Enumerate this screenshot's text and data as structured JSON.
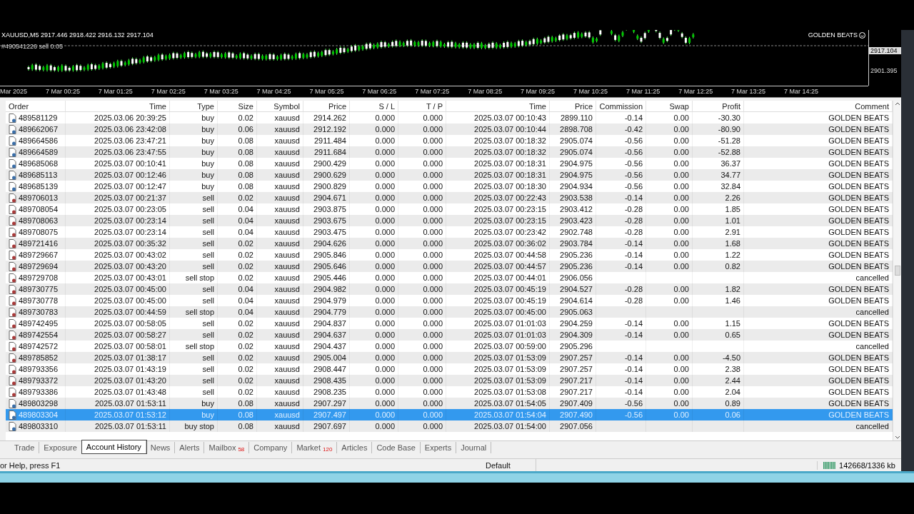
{
  "chart": {
    "title": "XAUUSD,M5  2917.446 2918.422 2916.132 2917.104",
    "order_line": "#490541226 sell 0.05",
    "expert": "GOLDEN BEATS",
    "price_labels": [
      "2917.104",
      "2901.395"
    ],
    "time_labels": [
      "Mar 2025",
      "7 Mar 00:25",
      "7 Mar 01:25",
      "7 Mar 02:25",
      "7 Mar 03:25",
      "7 Mar 04:25",
      "7 Mar 05:25",
      "7 Mar 06:25",
      "7 Mar 07:25",
      "7 Mar 08:25",
      "7 Mar 09:25",
      "7 Mar 10:25",
      "7 Mar 11:25",
      "7 Mar 12:25",
      "7 Mar 13:25",
      "7 Mar 14:25"
    ]
  },
  "table": {
    "columns": [
      "Order",
      "Time",
      "Type",
      "Size",
      "Symbol",
      "Price",
      "S / L",
      "T / P",
      "Time",
      "Price",
      "Commission",
      "Swap",
      "Profit",
      "Comment"
    ],
    "rows": [
      {
        "kind": "buy",
        "selected": false,
        "cells": [
          "489581129",
          "2025.03.06 20:39:25",
          "buy",
          "0.02",
          "xauusd",
          "2914.262",
          "0.000",
          "0.000",
          "2025.03.07 00:10:43",
          "2899.110",
          "-0.14",
          "0.00",
          "-30.30",
          "GOLDEN BEATS"
        ]
      },
      {
        "kind": "buy",
        "selected": false,
        "cells": [
          "489662067",
          "2025.03.06 23:42:08",
          "buy",
          "0.06",
          "xauusd",
          "2912.192",
          "0.000",
          "0.000",
          "2025.03.07 00:10:44",
          "2898.708",
          "-0.42",
          "0.00",
          "-80.90",
          "GOLDEN BEATS"
        ]
      },
      {
        "kind": "buy",
        "selected": false,
        "cells": [
          "489664586",
          "2025.03.06 23:47:21",
          "buy",
          "0.08",
          "xauusd",
          "2911.484",
          "0.000",
          "0.000",
          "2025.03.07 00:18:32",
          "2905.074",
          "-0.56",
          "0.00",
          "-51.28",
          "GOLDEN BEATS"
        ]
      },
      {
        "kind": "buy",
        "selected": false,
        "cells": [
          "489664589",
          "2025.03.06 23:47:55",
          "buy",
          "0.08",
          "xauusd",
          "2911.684",
          "0.000",
          "0.000",
          "2025.03.07 00:18:32",
          "2905.074",
          "-0.56",
          "0.00",
          "-52.88",
          "GOLDEN BEATS"
        ]
      },
      {
        "kind": "buy",
        "selected": false,
        "cells": [
          "489685068",
          "2025.03.07 00:10:41",
          "buy",
          "0.08",
          "xauusd",
          "2900.429",
          "0.000",
          "0.000",
          "2025.03.07 00:18:31",
          "2904.975",
          "-0.56",
          "0.00",
          "36.37",
          "GOLDEN BEATS"
        ]
      },
      {
        "kind": "buy",
        "selected": false,
        "cells": [
          "489685113",
          "2025.03.07 00:12:46",
          "buy",
          "0.08",
          "xauusd",
          "2900.629",
          "0.000",
          "0.000",
          "2025.03.07 00:18:31",
          "2904.975",
          "-0.56",
          "0.00",
          "34.77",
          "GOLDEN BEATS"
        ]
      },
      {
        "kind": "buy",
        "selected": false,
        "cells": [
          "489685139",
          "2025.03.07 00:12:47",
          "buy",
          "0.08",
          "xauusd",
          "2900.829",
          "0.000",
          "0.000",
          "2025.03.07 00:18:30",
          "2904.934",
          "-0.56",
          "0.00",
          "32.84",
          "GOLDEN BEATS"
        ]
      },
      {
        "kind": "sell",
        "selected": false,
        "cells": [
          "489706013",
          "2025.03.07 00:21:37",
          "sell",
          "0.02",
          "xauusd",
          "2904.671",
          "0.000",
          "0.000",
          "2025.03.07 00:22:43",
          "2903.538",
          "-0.14",
          "0.00",
          "2.26",
          "GOLDEN BEATS"
        ]
      },
      {
        "kind": "sell",
        "selected": false,
        "cells": [
          "489708054",
          "2025.03.07 00:23:05",
          "sell",
          "0.04",
          "xauusd",
          "2903.875",
          "0.000",
          "0.000",
          "2025.03.07 00:23:15",
          "2903.412",
          "-0.28",
          "0.00",
          "1.85",
          "GOLDEN BEATS"
        ]
      },
      {
        "kind": "sell",
        "selected": false,
        "cells": [
          "489708063",
          "2025.03.07 00:23:14",
          "sell",
          "0.04",
          "xauusd",
          "2903.675",
          "0.000",
          "0.000",
          "2025.03.07 00:23:15",
          "2903.423",
          "-0.28",
          "0.00",
          "1.01",
          "GOLDEN BEATS"
        ]
      },
      {
        "kind": "sell",
        "selected": false,
        "cells": [
          "489708075",
          "2025.03.07 00:23:14",
          "sell",
          "0.04",
          "xauusd",
          "2903.475",
          "0.000",
          "0.000",
          "2025.03.07 00:23:42",
          "2902.748",
          "-0.28",
          "0.00",
          "2.91",
          "GOLDEN BEATS"
        ]
      },
      {
        "kind": "sell",
        "selected": false,
        "cells": [
          "489721416",
          "2025.03.07 00:35:32",
          "sell",
          "0.02",
          "xauusd",
          "2904.626",
          "0.000",
          "0.000",
          "2025.03.07 00:36:02",
          "2903.784",
          "-0.14",
          "0.00",
          "1.68",
          "GOLDEN BEATS"
        ]
      },
      {
        "kind": "sell",
        "selected": false,
        "cells": [
          "489729667",
          "2025.03.07 00:43:02",
          "sell",
          "0.02",
          "xauusd",
          "2905.846",
          "0.000",
          "0.000",
          "2025.03.07 00:44:58",
          "2905.236",
          "-0.14",
          "0.00",
          "1.22",
          "GOLDEN BEATS"
        ]
      },
      {
        "kind": "sell",
        "selected": false,
        "cells": [
          "489729694",
          "2025.03.07 00:43:20",
          "sell",
          "0.02",
          "xauusd",
          "2905.646",
          "0.000",
          "0.000",
          "2025.03.07 00:44:57",
          "2905.236",
          "-0.14",
          "0.00",
          "0.82",
          "GOLDEN BEATS"
        ]
      },
      {
        "kind": "sell",
        "selected": false,
        "cells": [
          "489729708",
          "2025.03.07 00:43:01",
          "sell stop",
          "0.02",
          "xauusd",
          "2905.446",
          "0.000",
          "0.000",
          "2025.03.07 00:44:01",
          "2906.056",
          null,
          null,
          null,
          "cancelled"
        ]
      },
      {
        "kind": "sell",
        "selected": false,
        "cells": [
          "489730775",
          "2025.03.07 00:45:00",
          "sell",
          "0.04",
          "xauusd",
          "2904.982",
          "0.000",
          "0.000",
          "2025.03.07 00:45:19",
          "2904.527",
          "-0.28",
          "0.00",
          "1.82",
          "GOLDEN BEATS"
        ]
      },
      {
        "kind": "sell",
        "selected": false,
        "cells": [
          "489730778",
          "2025.03.07 00:45:00",
          "sell",
          "0.04",
          "xauusd",
          "2904.979",
          "0.000",
          "0.000",
          "2025.03.07 00:45:19",
          "2904.614",
          "-0.28",
          "0.00",
          "1.46",
          "GOLDEN BEATS"
        ]
      },
      {
        "kind": "sell",
        "selected": false,
        "cells": [
          "489730783",
          "2025.03.07 00:44:59",
          "sell stop",
          "0.04",
          "xauusd",
          "2904.779",
          "0.000",
          "0.000",
          "2025.03.07 00:45:00",
          "2905.063",
          null,
          null,
          null,
          "cancelled"
        ]
      },
      {
        "kind": "sell",
        "selected": false,
        "cells": [
          "489742495",
          "2025.03.07 00:58:05",
          "sell",
          "0.02",
          "xauusd",
          "2904.837",
          "0.000",
          "0.000",
          "2025.03.07 01:01:03",
          "2904.259",
          "-0.14",
          "0.00",
          "1.15",
          "GOLDEN BEATS"
        ]
      },
      {
        "kind": "sell",
        "selected": false,
        "cells": [
          "489742554",
          "2025.03.07 00:58:27",
          "sell",
          "0.02",
          "xauusd",
          "2904.637",
          "0.000",
          "0.000",
          "2025.03.07 01:01:03",
          "2904.309",
          "-0.14",
          "0.00",
          "0.65",
          "GOLDEN BEATS"
        ]
      },
      {
        "kind": "sell",
        "selected": false,
        "cells": [
          "489742572",
          "2025.03.07 00:58:01",
          "sell stop",
          "0.02",
          "xauusd",
          "2904.437",
          "0.000",
          "0.000",
          "2025.03.07 00:59:00",
          "2905.296",
          null,
          null,
          null,
          "cancelled"
        ]
      },
      {
        "kind": "sell",
        "selected": false,
        "cells": [
          "489785852",
          "2025.03.07 01:38:17",
          "sell",
          "0.02",
          "xauusd",
          "2905.004",
          "0.000",
          "0.000",
          "2025.03.07 01:53:09",
          "2907.257",
          "-0.14",
          "0.00",
          "-4.50",
          "GOLDEN BEATS"
        ]
      },
      {
        "kind": "sell",
        "selected": false,
        "cells": [
          "489793356",
          "2025.03.07 01:43:19",
          "sell",
          "0.02",
          "xauusd",
          "2908.447",
          "0.000",
          "0.000",
          "2025.03.07 01:53:09",
          "2907.257",
          "-0.14",
          "0.00",
          "2.38",
          "GOLDEN BEATS"
        ]
      },
      {
        "kind": "sell",
        "selected": false,
        "cells": [
          "489793372",
          "2025.03.07 01:43:20",
          "sell",
          "0.02",
          "xauusd",
          "2908.435",
          "0.000",
          "0.000",
          "2025.03.07 01:53:09",
          "2907.217",
          "-0.14",
          "0.00",
          "2.44",
          "GOLDEN BEATS"
        ]
      },
      {
        "kind": "sell",
        "selected": false,
        "cells": [
          "489793386",
          "2025.03.07 01:43:48",
          "sell",
          "0.02",
          "xauusd",
          "2908.235",
          "0.000",
          "0.000",
          "2025.03.07 01:53:08",
          "2907.217",
          "-0.14",
          "0.00",
          "2.04",
          "GOLDEN BEATS"
        ]
      },
      {
        "kind": "buy",
        "selected": false,
        "cells": [
          "489803298",
          "2025.03.07 01:53:11",
          "buy",
          "0.08",
          "xauusd",
          "2907.297",
          "0.000",
          "0.000",
          "2025.03.07 01:54:05",
          "2907.409",
          "-0.56",
          "0.00",
          "0.89",
          "GOLDEN BEATS"
        ]
      },
      {
        "kind": "buy",
        "selected": true,
        "cells": [
          "489803304",
          "2025.03.07 01:53:12",
          "buy",
          "0.08",
          "xauusd",
          "2907.497",
          "0.000",
          "0.000",
          "2025.03.07 01:54:04",
          "2907.490",
          "-0.56",
          "0.00",
          "0.06",
          "GOLDEN BEATS"
        ]
      },
      {
        "kind": "buy",
        "selected": false,
        "cells": [
          "489803310",
          "2025.03.07 01:53:11",
          "buy stop",
          "0.08",
          "xauusd",
          "2907.697",
          "0.000",
          "0.000",
          "2025.03.07 01:54:00",
          "2907.056",
          null,
          null,
          null,
          "cancelled"
        ]
      }
    ]
  },
  "tabs": [
    {
      "label": "Trade",
      "selected": false
    },
    {
      "label": "Exposure",
      "selected": false
    },
    {
      "label": "Account History",
      "selected": true
    },
    {
      "label": "News",
      "selected": false
    },
    {
      "label": "Alerts",
      "selected": false
    },
    {
      "label": "Mailbox",
      "badge": "58",
      "selected": false
    },
    {
      "label": "Company",
      "selected": false
    },
    {
      "label": "Market",
      "badge": "120",
      "selected": false
    },
    {
      "label": "Articles",
      "selected": false
    },
    {
      "label": "Code Base",
      "selected": false
    },
    {
      "label": "Experts",
      "selected": false
    },
    {
      "label": "Journal",
      "selected": false
    }
  ],
  "status_bar": {
    "help": "or Help, press F1",
    "profile": "Default",
    "traffic": "142668/1336 kb"
  }
}
